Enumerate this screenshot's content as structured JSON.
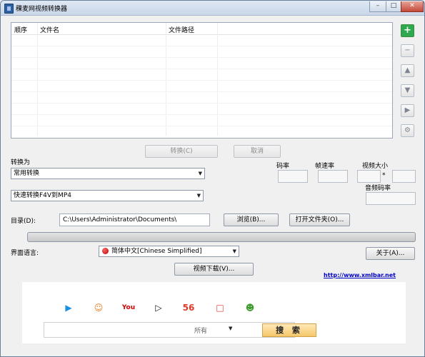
{
  "window": {
    "title": "稞麦网视频转换器",
    "controls": {
      "minimize": "–",
      "maximize": "□",
      "close": "✕"
    }
  },
  "file_list": {
    "columns": [
      "顺序",
      "文件名",
      "文件路径"
    ]
  },
  "side_buttons": [
    {
      "name": "add-icon",
      "glyph": "+"
    },
    {
      "name": "remove-icon",
      "glyph": "−"
    },
    {
      "name": "move-up-icon",
      "glyph": "▲"
    },
    {
      "name": "move-down-icon",
      "glyph": "▼"
    },
    {
      "name": "play-icon",
      "glyph": "▶"
    },
    {
      "name": "settings-icon",
      "glyph": "⚙"
    }
  ],
  "actions": {
    "convert": "转换(C)",
    "cancel": "取消"
  },
  "convert_to": {
    "label": "转换为",
    "mode_value": "常用转换",
    "preset_value": "快速转换F4V到MP4"
  },
  "params": {
    "bitrate_label": "码率",
    "framerate_label": "帧速率",
    "video_size_label": "视频大小",
    "size_separator": "*",
    "audio_bitrate_label": "音频码率"
  },
  "directory": {
    "label": "目录(D):",
    "value": "C:\\Users\\Administrator\\Documents\\",
    "browse": "浏览(B)...",
    "open_folder": "打开文件夹(O)..."
  },
  "language": {
    "label": "界面语言:",
    "value": "简体中文[Chinese Simplified]",
    "about": "关于(A)..."
  },
  "video_download": "视频下载(V)...",
  "website": "http://www.xmlbar.net",
  "bottom_banner": {
    "sites": [
      {
        "name": "youku-icon",
        "glyph": "▶",
        "color": "#1b8fe0"
      },
      {
        "name": "tudou-icon",
        "glyph": "☺",
        "color": "#f07d1b"
      },
      {
        "name": "youtube-icon",
        "glyph": "You",
        "color": "#d40000"
      },
      {
        "name": "iqiyi-icon",
        "glyph": "▷",
        "color": "#111111"
      },
      {
        "name": "56-icon",
        "glyph": "56",
        "color": "#e03a2a"
      },
      {
        "name": "sohu-icon",
        "glyph": "□",
        "color": "#e03a2a"
      },
      {
        "name": "ku6-icon",
        "glyph": "☻",
        "color": "#3a9a2a"
      }
    ],
    "search_option": "所有",
    "search_button": "搜 索"
  },
  "colors": {
    "accent_green": "#2fa84f",
    "link_blue": "#0000cc"
  }
}
